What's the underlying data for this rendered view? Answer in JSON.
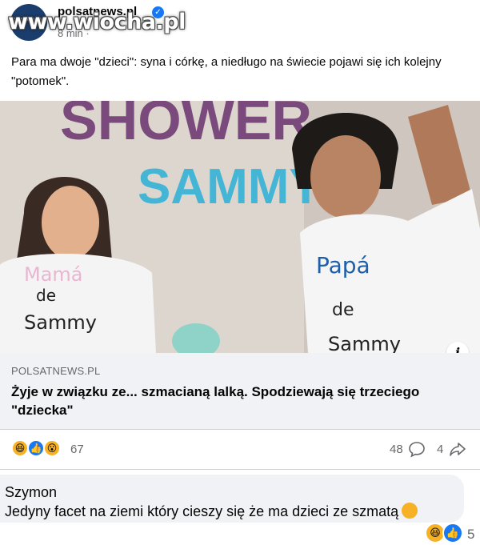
{
  "post": {
    "page_name": "polsatnews.pl",
    "avatar_text": "polsat news",
    "time": "8 min ·",
    "watermark": "www.wiocha.pl",
    "text": "Para ma dwoje \"dzieci\": syna i córkę, a niedługo na świecie pojawi się ich kolejny \"potomek\"."
  },
  "image": {
    "wall_text_1": "SHOWER",
    "wall_text_2": "SAMMY",
    "left_shirt_1": "Mamá",
    "left_shirt_2": "de",
    "left_shirt_3": "Sammy",
    "right_shirt_1": "Papá",
    "right_shirt_2": "de",
    "right_shirt_3": "Sammy",
    "info_glyph": "i"
  },
  "link": {
    "domain": "POLSATNEWS.PL",
    "title": "Żyje w związku ze... szmacianą lalką. Spodziewają się trzeciego \"dziecka\""
  },
  "stats": {
    "reactions": "67",
    "comments": "48",
    "shares": "4"
  },
  "comment": {
    "author": "Szymon",
    "text": "Jedyny facet na ziemi który cieszy się że ma dzieci ze szmatą",
    "reaction_count": "5"
  },
  "icons": {
    "verified": "verified-badge-icon",
    "haha": "haha-reaction-icon",
    "like": "like-reaction-icon",
    "wow": "wow-reaction-icon",
    "comment": "comment-icon",
    "share": "share-icon",
    "info": "info-icon"
  },
  "colors": {
    "brand_blue": "#1877f2",
    "caption_bg": "#f0f2f5",
    "meta_gray": "#65676b",
    "wall_purple": "#7b4a7c",
    "wall_teal": "#45b5d6"
  }
}
